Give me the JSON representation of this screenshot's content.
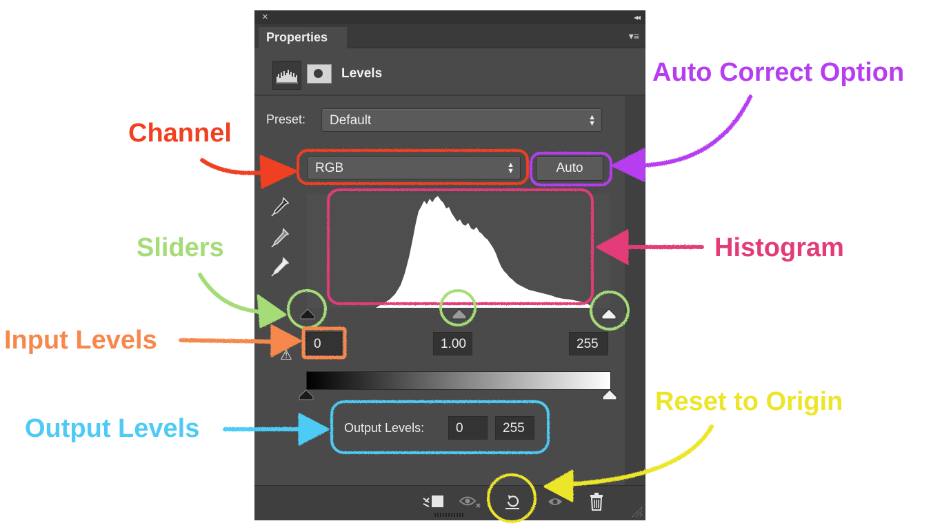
{
  "panel": {
    "close_glyph": "×",
    "collapse_glyph": "◂◂",
    "tab_title": "Properties",
    "menu_glyph": "▾≡",
    "adjustment_title": "Levels"
  },
  "preset": {
    "label": "Preset:",
    "value": "Default"
  },
  "channel": {
    "value": "RGB"
  },
  "auto_button": {
    "label": "Auto"
  },
  "input_levels": {
    "black": "0",
    "gamma": "1.00",
    "white": "255"
  },
  "output_levels": {
    "label": "Output Levels:",
    "black": "0",
    "white": "255"
  },
  "annotations": {
    "auto_correct": {
      "text": "Auto Correct Option",
      "color": "#b63ef0"
    },
    "channel": {
      "text": "Channel",
      "color": "#f04020"
    },
    "sliders": {
      "text": "Sliders",
      "color": "#a5dc78"
    },
    "histogram": {
      "text": "Histogram",
      "color": "#e23c78"
    },
    "input_levels": {
      "text": "Input Levels",
      "color": "#f6884e"
    },
    "output_levels": {
      "text": "Output Levels",
      "color": "#4ecbf4"
    },
    "reset": {
      "text": "Reset to Origin",
      "color": "#ece62a"
    }
  },
  "icons": {
    "histogram_adjust": "histogram-icon",
    "mask": "mask-icon",
    "pipette": "eyedropper-icon",
    "clip": "clip-to-layer-icon",
    "view_previous": "view-previous-icon",
    "reset": "reset-icon",
    "visibility": "visibility-icon",
    "delete": "trash-icon",
    "warning": "warning-icon"
  }
}
